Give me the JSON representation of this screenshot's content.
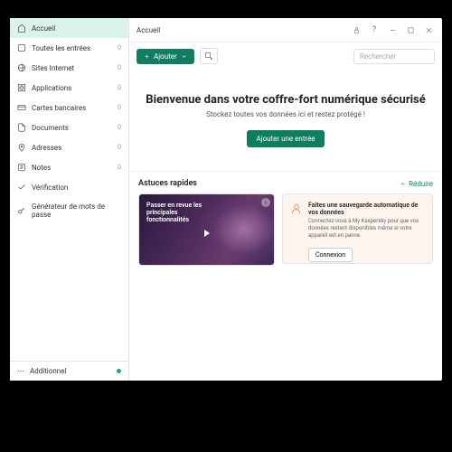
{
  "sidebar": {
    "items": [
      {
        "label": "Accueil",
        "count": "",
        "active": true
      },
      {
        "label": "Toutes les entrées",
        "count": "0"
      },
      {
        "label": "Sites Internet",
        "count": "0"
      },
      {
        "label": "Applications",
        "count": "0"
      },
      {
        "label": "Cartes bancaires",
        "count": "0"
      },
      {
        "label": "Documents",
        "count": "0"
      },
      {
        "label": "Adresses",
        "count": "0"
      },
      {
        "label": "Notes",
        "count": "0"
      },
      {
        "label": "Vérification",
        "count": ""
      },
      {
        "label": "Générateur de mots de passe",
        "count": ""
      }
    ],
    "bottom": {
      "label": "Additionnel"
    }
  },
  "header": {
    "breadcrumb": "Accueil"
  },
  "toolbar": {
    "add_label": "Ajouter",
    "search_placeholder": "Rechercher"
  },
  "hero": {
    "title": "Bienvenue dans votre coffre-fort numérique sécurisé",
    "subtitle": "Stockez toutes vos données ici et restez protégé !",
    "cta": "Ajouter une entrée"
  },
  "tips": {
    "heading": "Astuces rapides",
    "reduce": "Réduire",
    "video_title": "Passer en revue les principales fonctionnalités",
    "backup_title": "Faites une sauvegarde automatique de vos données",
    "backup_desc": "Connectez-vous à My Kaspersky pour que vos données restent disponibles même si votre appareil est en panne.",
    "login": "Connexion"
  }
}
